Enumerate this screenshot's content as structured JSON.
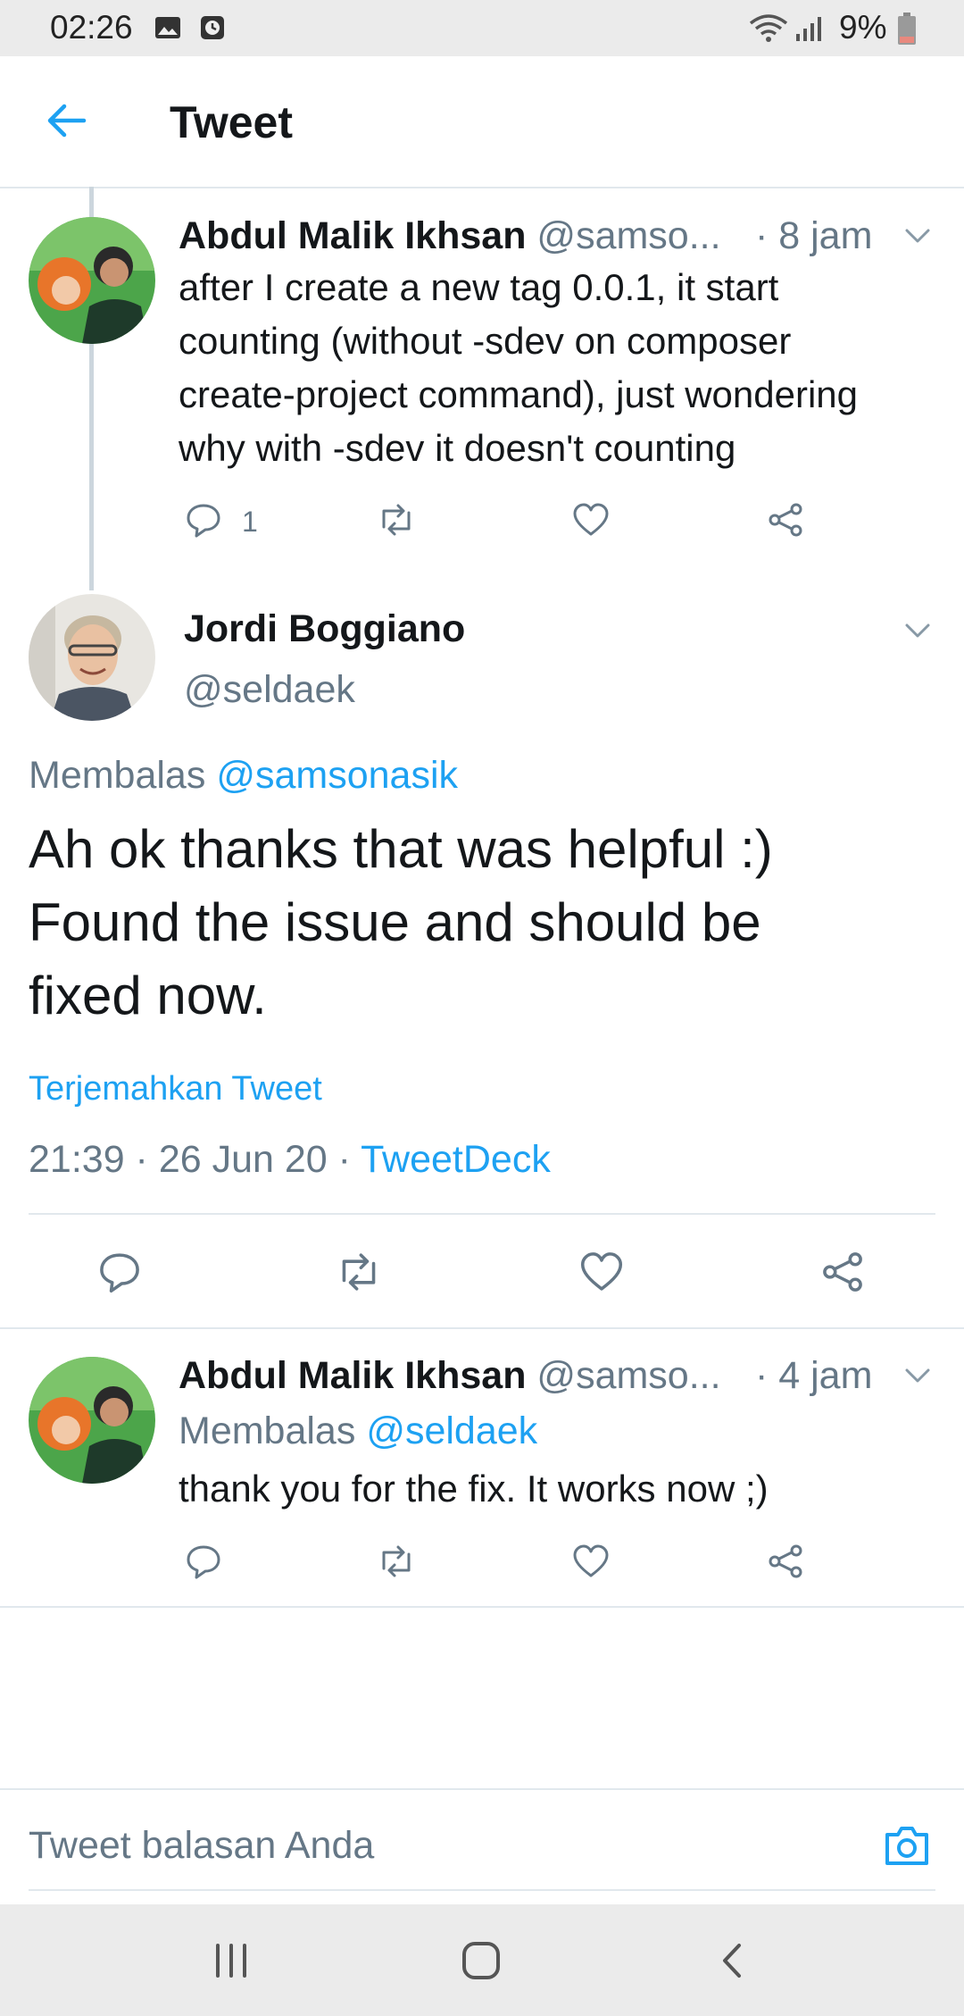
{
  "status_bar": {
    "time": "02:26",
    "battery": "9%"
  },
  "header": {
    "title": "Tweet"
  },
  "tweets": [
    {
      "name": "Abdul Malik Ikhsan",
      "handle": "@samso...",
      "time": "· 8 jam",
      "text_lines": [
        "after I create a new tag 0.0.1, it start",
        "counting (without -sdev on composer",
        "create-project command), just wondering",
        "why with -sdev it doesn't counting"
      ],
      "reply_count": "1"
    },
    {
      "name": "Jordi Boggiano",
      "handle": "@seldaek",
      "reply_prefix": "Membalas",
      "reply_to": "@samsonasik",
      "text_lines": [
        "Ah ok thanks that was helpful :)",
        "Found the issue and should be",
        "fixed now."
      ],
      "translate": "Terjemahkan Tweet",
      "timestamp": "21:39 · 26 Jun 20 ·",
      "client": "TweetDeck"
    },
    {
      "name": "Abdul Malik Ikhsan",
      "handle": "@samso...",
      "time": "· 4 jam",
      "reply_prefix": "Membalas",
      "reply_to": "@seldaek",
      "text": "thank you for the fix. It works now ;)"
    }
  ],
  "composer": {
    "placeholder": "Tweet balasan Anda"
  },
  "colors": {
    "accent": "#1da1f2",
    "muted": "#657786",
    "text": "#14171a"
  }
}
